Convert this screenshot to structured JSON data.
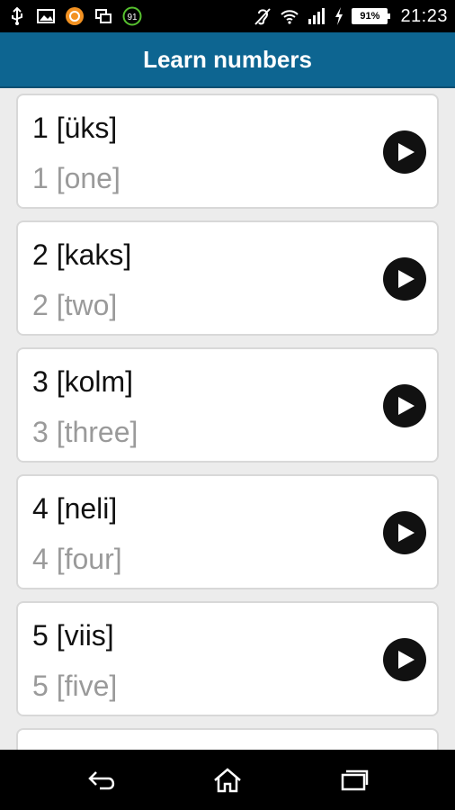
{
  "status_bar": {
    "time": "21:23",
    "battery": "91%",
    "notification_badge": "91",
    "icons": [
      "usb-icon",
      "image-icon",
      "app-notification-icon",
      "screens-icon",
      "counter-badge-icon",
      "hearing-aid-icon",
      "wifi-icon",
      "signal-icon",
      "charging-icon",
      "battery-icon"
    ]
  },
  "app_bar": {
    "title": "Learn numbers"
  },
  "items": [
    {
      "word": "1 [üks]",
      "translation": "1 [one]"
    },
    {
      "word": "2 [kaks]",
      "translation": "2 [two]"
    },
    {
      "word": "3 [kolm]",
      "translation": "3 [three]"
    },
    {
      "word": "4 [neli]",
      "translation": "4 [four]"
    },
    {
      "word": "5 [viis]",
      "translation": "5 [five]"
    }
  ],
  "nav_bar": {
    "icons": [
      "back-icon",
      "home-icon",
      "recent-apps-icon"
    ]
  },
  "colors": {
    "app_bar": "#0d6591",
    "card_border": "#d8d8d8",
    "translation_text": "#9a9a9a"
  }
}
